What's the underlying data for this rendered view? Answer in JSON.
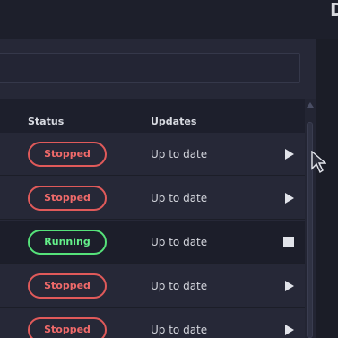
{
  "window": {
    "corner_title": "D"
  },
  "search": {
    "placeholder": ""
  },
  "table": {
    "columns": {
      "status": "Status",
      "updates": "Updates"
    },
    "rows": [
      {
        "status": "Stopped",
        "update": "Up to date",
        "action_icon": "play-icon"
      },
      {
        "status": "Stopped",
        "update": "Up to date",
        "action_icon": "play-icon"
      },
      {
        "status": "Running",
        "update": "Up to date",
        "action_icon": "stop-icon"
      },
      {
        "status": "Stopped",
        "update": "Up to date",
        "action_icon": "play-icon"
      },
      {
        "status": "Stopped",
        "update": "Up to date",
        "action_icon": "play-icon"
      }
    ]
  },
  "colors": {
    "stopped": "#e05a5a",
    "running": "#56e27a",
    "background": "#262837",
    "header": "#1d1f2c"
  }
}
